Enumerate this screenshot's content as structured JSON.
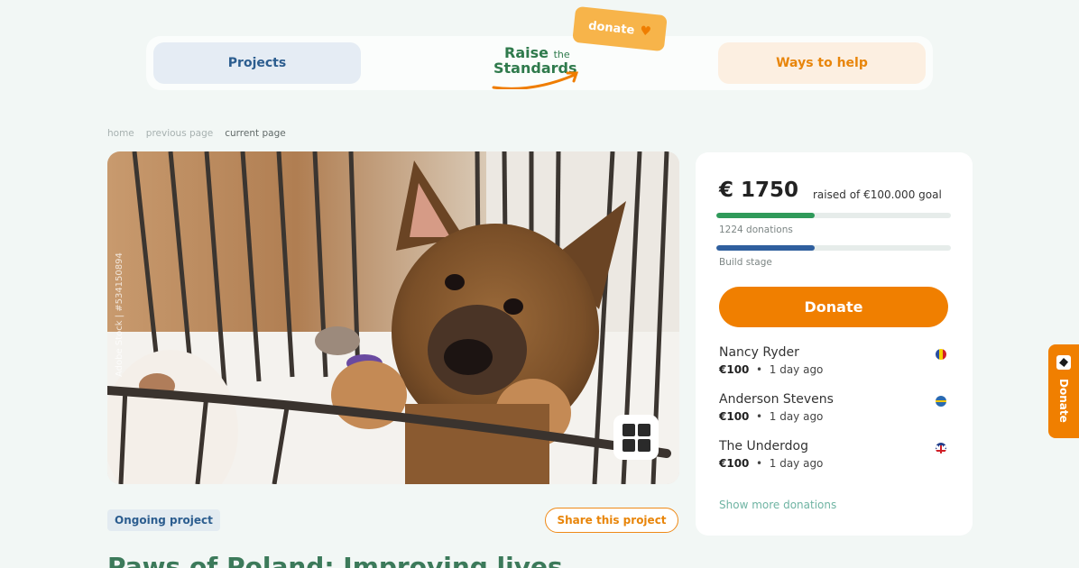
{
  "nav": {
    "projects_label": "Projects",
    "ways_label": "Ways to help",
    "logo_line1": "Raise",
    "logo_the": "the",
    "logo_line2": "Standards",
    "donate_tag": "donate",
    "donate_tag_icon": "heart-icon"
  },
  "breadcrumb": [
    "home",
    "previous page",
    "current page"
  ],
  "hero": {
    "watermark": "Adobe Stock | #534150894",
    "gallery_icon": "grid-icon"
  },
  "project": {
    "status": "Ongoing project",
    "share_label": "Share this project",
    "title": "Paws of Poland: Improving lives"
  },
  "panel": {
    "amount": "€ 1750",
    "goal": "raised of €100.000 goal",
    "donations_progress": 0.42,
    "donations_label": "1224 donations",
    "build_progress": 0.42,
    "build_label": "Build stage",
    "donate_label": "Donate",
    "donations": [
      {
        "name": "Nancy Ryder",
        "amount": "€100",
        "when": "1 day ago",
        "flag": "romania-flag-icon"
      },
      {
        "name": "Anderson Stevens",
        "amount": "€100",
        "when": "1 day ago",
        "flag": "sweden-flag-icon"
      },
      {
        "name": "The Underdog",
        "amount": "€100",
        "when": "1 day ago",
        "flag": "uk-flag-icon"
      }
    ],
    "show_more": "Show more donations"
  },
  "side_tab": {
    "label": "Donate",
    "icon": "emblem-icon"
  },
  "colors": {
    "accent_orange": "#f07f00",
    "green": "#2f9a5a",
    "blue": "#2f5f9e",
    "background": "#f2f7f5"
  }
}
